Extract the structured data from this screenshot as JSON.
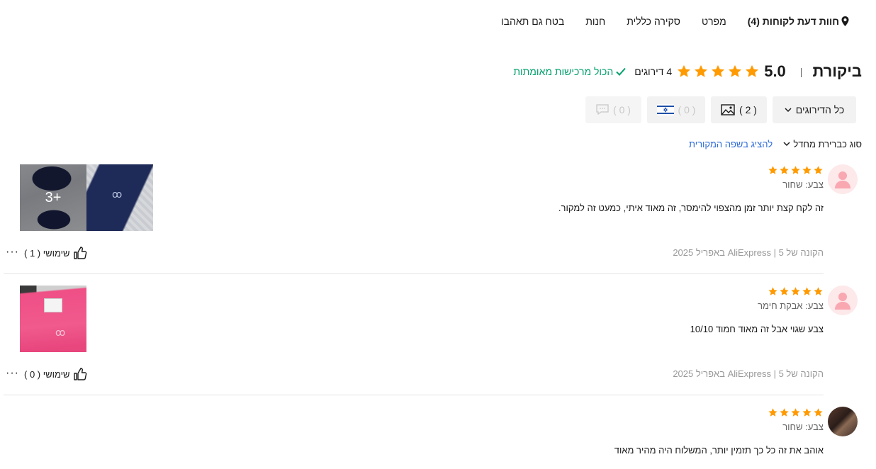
{
  "tabs": [
    {
      "label": "חוות דעת לקוחות (4)",
      "active": true,
      "icon": "map-pin-icon"
    },
    {
      "label": "מפרט",
      "active": false
    },
    {
      "label": "סקירה כללית",
      "active": false
    },
    {
      "label": "חנות",
      "active": false
    },
    {
      "label": "בטח גם תאהבו",
      "active": false
    }
  ],
  "header": {
    "title": "ביקורת",
    "separator": "|",
    "score": "5.0",
    "stars": 5,
    "rating_count": "4 דירוגים",
    "verified": "הכול מרכישות מאומתות",
    "verified_color": "#00a06b",
    "star_color": "#ff9a00"
  },
  "filters": {
    "all_ratings": "כל הדירוגים",
    "photos": "( 2 )",
    "local": "( 0 )",
    "comments": "( 0 )"
  },
  "sort": {
    "label": "סוג כברירת מחדל",
    "show_original": "להציג בשפה המקורית"
  },
  "reviews": [
    {
      "stars": 5,
      "color": "צבע: שחור",
      "text": "זה לקח קצת יותר זמן מהצפוי להימסר, זה מאוד איתי, כמעט זה למקור.",
      "meta": "הקונה של AliExpress | 5 באפריל 2025",
      "helpful": "שימושי ( 1 )",
      "more_photos": "3+",
      "avatar": "user-placeholder"
    },
    {
      "stars": 5,
      "color": "צבע: אבקת חימר",
      "text": "צבע שגוי אבל זה מאוד חמוד 10/10",
      "meta": "הקונה של AliExpress | 5 באפריל 2025",
      "helpful": "שימושי ( 0 )",
      "avatar": "user-placeholder"
    },
    {
      "stars": 5,
      "color": "צבע: שחור",
      "text": "אוהב את זה כל כך תזמין יותר, המשלוח היה מהיר מאוד",
      "avatar": "user-photo"
    }
  ],
  "more_label": "···"
}
